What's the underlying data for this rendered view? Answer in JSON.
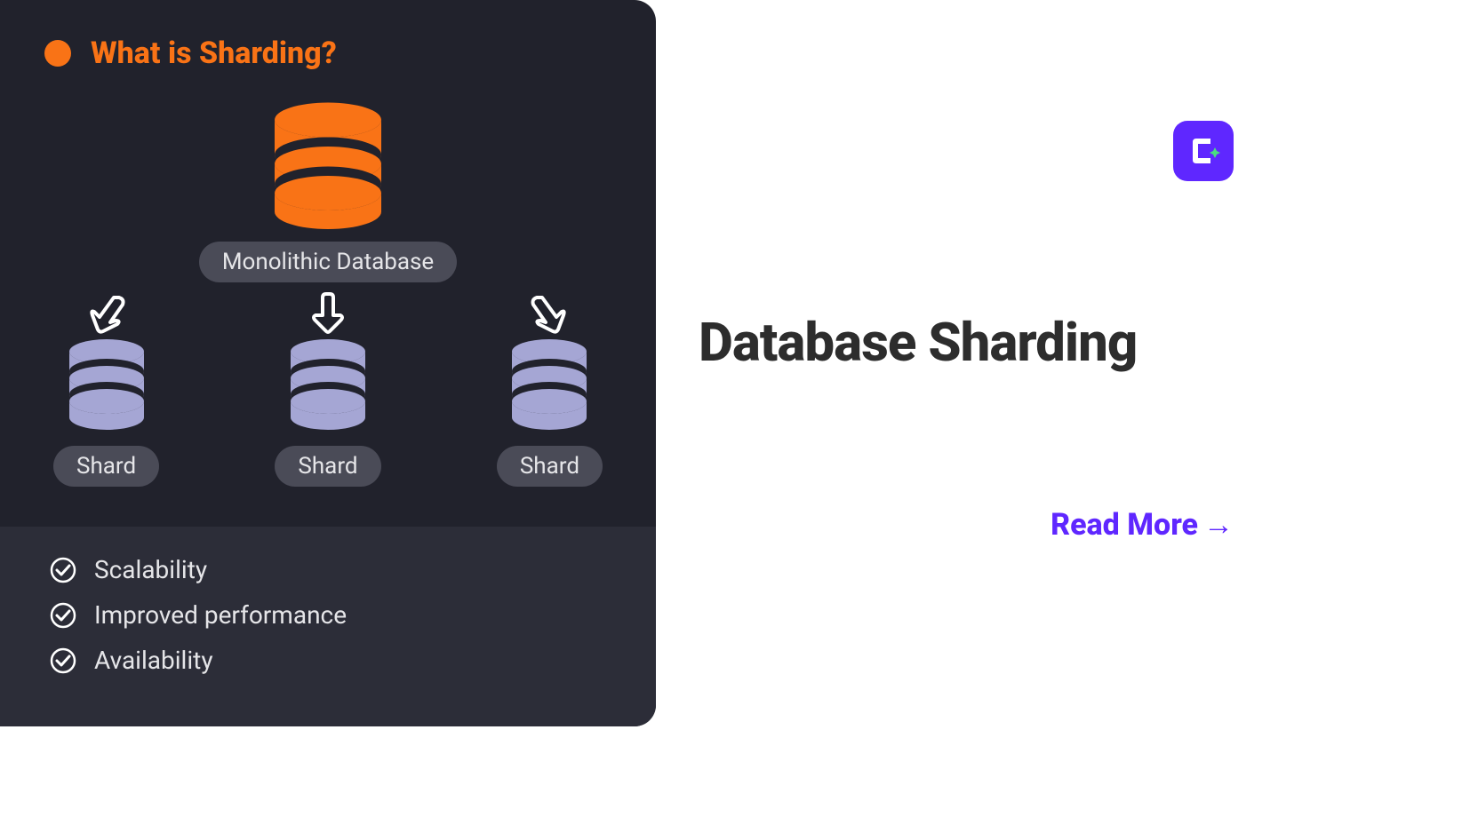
{
  "left": {
    "heading": "What is Sharding?",
    "main_db_label": "Monolithic Database",
    "shard_labels": [
      "Shard",
      "Shard",
      "Shard"
    ],
    "benefits": [
      "Scalability",
      "Improved performance",
      "Availability"
    ]
  },
  "right": {
    "title": "Database Sharding",
    "cta": "Read More"
  },
  "colors": {
    "accent_orange": "#f97316",
    "accent_purple": "#5f27ff",
    "shard_fill": "#a5a6d4"
  }
}
